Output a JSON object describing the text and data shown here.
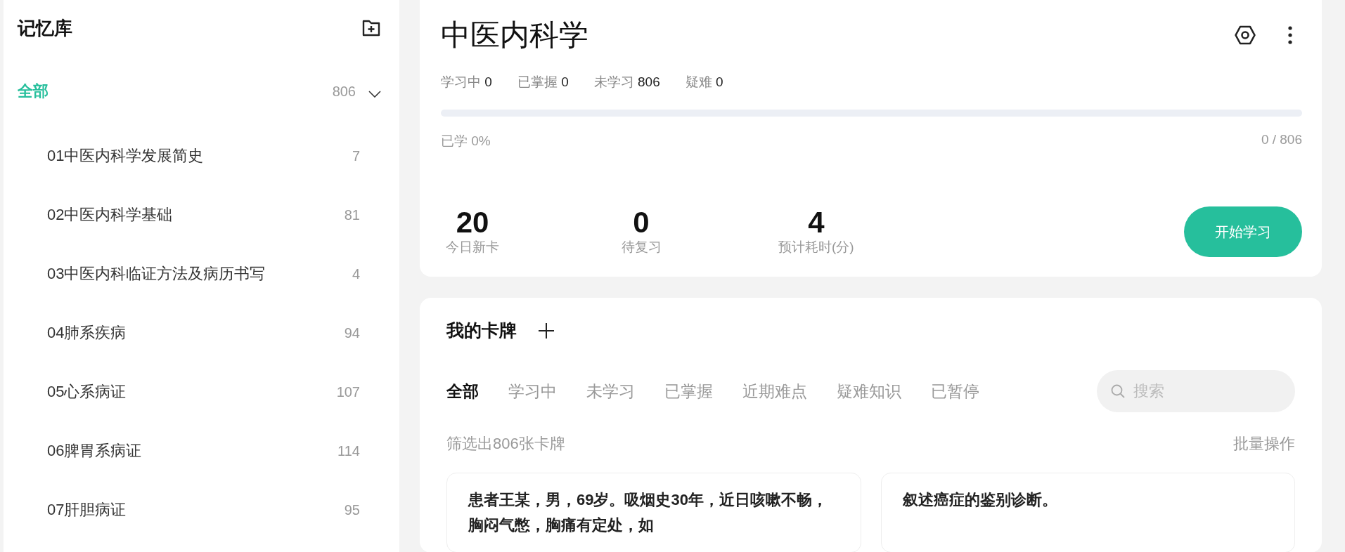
{
  "sidebar": {
    "title": "记忆库",
    "tree": [
      {
        "label": "全部",
        "count": "806",
        "selected": true,
        "expanded": true,
        "children": [
          {
            "label": "01中医内科学发展简史",
            "count": "7",
            "selected": false
          },
          {
            "label": "02中医内科学基础",
            "count": "81",
            "selected": false
          },
          {
            "label": "03中医内科临证方法及病历书写",
            "count": "4",
            "selected": false
          },
          {
            "label": "04肺系疾病",
            "count": "94",
            "selected": false
          },
          {
            "label": "05心系病证",
            "count": "107",
            "selected": false
          },
          {
            "label": "06脾胃系病证",
            "count": "114",
            "selected": false
          },
          {
            "label": "07肝胆病证",
            "count": "95",
            "selected": false
          }
        ]
      }
    ]
  },
  "deck": {
    "title": "中医内科学",
    "stats": [
      {
        "label": "学习中",
        "value": "0"
      },
      {
        "label": "已掌握",
        "value": "0"
      },
      {
        "label": "未学习",
        "value": "806"
      },
      {
        "label": "疑难",
        "value": "0"
      }
    ],
    "progress": {
      "level": 0,
      "label": "已学 0%",
      "reading": "0 / 806"
    },
    "today": [
      {
        "value": "20",
        "label": "今日新卡"
      },
      {
        "value": "0",
        "label": "待复习"
      },
      {
        "value": "4",
        "label": "预计耗时(分)"
      }
    ],
    "start_button": "开始学习"
  },
  "cards": {
    "title": "我的卡牌",
    "tabs": [
      {
        "label": "全部",
        "selected": true
      },
      {
        "label": "学习中",
        "selected": false
      },
      {
        "label": "未学习",
        "selected": false
      },
      {
        "label": "已掌握",
        "selected": false
      },
      {
        "label": "近期难点",
        "selected": false
      },
      {
        "label": "疑难知识",
        "selected": false
      },
      {
        "label": "已暂停",
        "selected": false
      }
    ],
    "search": {
      "placeholder": "搜索"
    },
    "filter_summary": "筛选出806张卡牌",
    "bulk_action": "批量操作",
    "items": [
      {
        "text": "患者王某，男，69岁。吸烟史30年，近日咳嗽不畅，胸闷气憋，胸痛有定处，如"
      },
      {
        "text": "叙述癌症的鉴别诊断。"
      }
    ]
  }
}
